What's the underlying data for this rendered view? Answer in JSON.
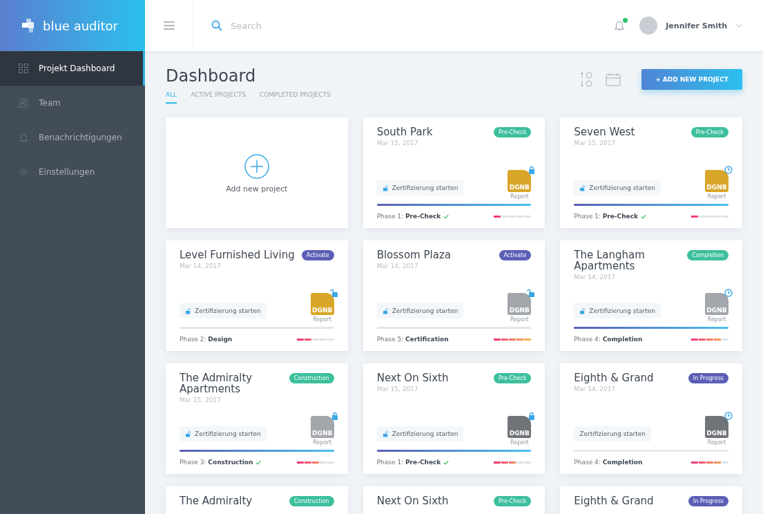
{
  "brand": {
    "name": "blue auditor"
  },
  "sidebar": {
    "items": [
      {
        "label": "Projekt Dashboard",
        "selected": true
      },
      {
        "label": "Team",
        "selected": false
      },
      {
        "label": "Benachrichtigungen",
        "selected": false
      },
      {
        "label": "Einstellungen",
        "selected": false
      }
    ]
  },
  "header": {
    "search": {
      "placeholder": "Search"
    },
    "notifications": {
      "unread": true
    },
    "user": {
      "name": "Jennifer Smith"
    }
  },
  "page": {
    "title": "Dashboard",
    "add_button": "+ ADD NEW PROJECT",
    "tabs": [
      {
        "label": "ALL",
        "selected": true
      },
      {
        "label": "ACTIVE PROJECTS",
        "selected": false
      },
      {
        "label": "COMPLETED PROJECTS",
        "selected": false
      }
    ]
  },
  "add_card": {
    "label": "Add new project"
  },
  "cards": [
    {
      "title": "South Park",
      "date": "Mar 15, 2017",
      "badge": {
        "text": "Pre-Check",
        "color": "#3dbf9c"
      },
      "report": {
        "logo": "DGNB",
        "caption": "Report",
        "color": "#d9a62a",
        "kind": "lock"
      },
      "action": {
        "label": "Zertifizierung starten",
        "icon": true
      },
      "progress": {
        "level": 1
      },
      "phase_label": "Phase 1:",
      "phase": "Pre-Check",
      "done": true,
      "meter": {
        "level": 0.2
      }
    },
    {
      "title": "Seven West",
      "date": "Mar 15, 2017",
      "badge": {
        "text": "Pre-Check",
        "color": "#3dbf9c"
      },
      "report": {
        "logo": "DGNB",
        "caption": "Report",
        "color": "#d9a62a",
        "kind": "clock"
      },
      "action": {
        "label": "Zertifizierung starten",
        "icon": true
      },
      "progress": {
        "level": 1
      },
      "phase_label": "Phase 1:",
      "phase": "Pre-Check",
      "done": true,
      "meter": {
        "level": 0.2
      }
    },
    {
      "title": "Level Furnished Living",
      "date": "Mar 14, 2017",
      "badge": {
        "text": "Activate",
        "color": "#5b5fb5"
      },
      "report": {
        "logo": "DGNB",
        "caption": "Report",
        "color": "#d9a62a",
        "kind": "unlock"
      },
      "action": {
        "label": "Zertifizierung starten",
        "icon": true
      },
      "progress": {
        "level": 0
      },
      "phase_label": "Phase 2:",
      "phase": "Design",
      "done": false,
      "meter": {
        "level": 0.4
      }
    },
    {
      "title": "Blossom Plaza",
      "date": "Mar 14, 2017",
      "badge": {
        "text": "Activate",
        "color": "#5b5fb5"
      },
      "report": {
        "logo": "DGNB",
        "caption": "Report",
        "color": "#a3a6ab",
        "kind": "unlock"
      },
      "action": {
        "label": "Zertifizierung starten",
        "icon": true
      },
      "progress": {
        "level": 0
      },
      "phase_label": "Phase 5:",
      "phase": "Certification",
      "done": false,
      "meter": {
        "level": 1
      }
    },
    {
      "title": "The Langham Apartments",
      "date": "Mar 14, 2017",
      "badge": {
        "text": "Completion",
        "color": "#3dbf9c"
      },
      "report": {
        "logo": "DGNB",
        "caption": "Report",
        "color": "#a3a6ab",
        "kind": "clock"
      },
      "action": {
        "label": "Zertifizierung starten",
        "icon": true
      },
      "progress": {
        "level": 1
      },
      "phase_label": "Phase 4:",
      "phase": "Completion",
      "done": false,
      "meter": {
        "level": 0.8
      }
    },
    {
      "title": "The Admiralty Apartments",
      "date": "Mar 15, 2017",
      "badge": {
        "text": "Construction",
        "color": "#3dbf9c"
      },
      "report": {
        "logo": "DGNB",
        "caption": "Report",
        "color": "#a3a6ab",
        "kind": "lock"
      },
      "action": {
        "label": "Zertifizierung starten",
        "icon": true
      },
      "progress": {
        "level": 1
      },
      "phase_label": "Phase 3:",
      "phase": "Construction",
      "done": true,
      "meter": {
        "level": 0.6
      }
    },
    {
      "title": "Next On Sixth",
      "date": "Mar 15, 2017",
      "badge": {
        "text": "Pre-Check",
        "color": "#3dbf9c"
      },
      "report": {
        "logo": "DGNB",
        "caption": "Report",
        "color": "#707378",
        "kind": "lock"
      },
      "action": {
        "label": "Zertifizierung starten",
        "icon": true
      },
      "progress": {
        "level": 1
      },
      "phase_label": "Phase 1:",
      "phase": "Pre-Check",
      "done": true,
      "meter": {
        "level": 0.6
      }
    },
    {
      "title": "Eighth & Grand",
      "date": "Mar 14, 2017",
      "badge": {
        "text": "In Progress",
        "color": "#5b5fb5"
      },
      "report": {
        "logo": "DGNB",
        "caption": "Report",
        "color": "#707378",
        "kind": "clock"
      },
      "action": {
        "label": "Zertifizierung starten",
        "icon": false
      },
      "progress": {
        "level": 0
      },
      "phase_label": "Phase 4:",
      "phase": "Completion",
      "done": false,
      "meter": {
        "level": 0.8
      }
    }
  ],
  "cut_off_cards": [
    {
      "title": "The Admiralty",
      "badge": {
        "text": "Construction",
        "color": "#3dbf9c"
      }
    },
    {
      "title": "Next On Sixth",
      "badge": {
        "text": "Pre-Check",
        "color": "#3dbf9c"
      }
    },
    {
      "title": "Eighth & Grand",
      "badge": {
        "text": "In Progress",
        "color": "#5b5fb5"
      }
    }
  ]
}
